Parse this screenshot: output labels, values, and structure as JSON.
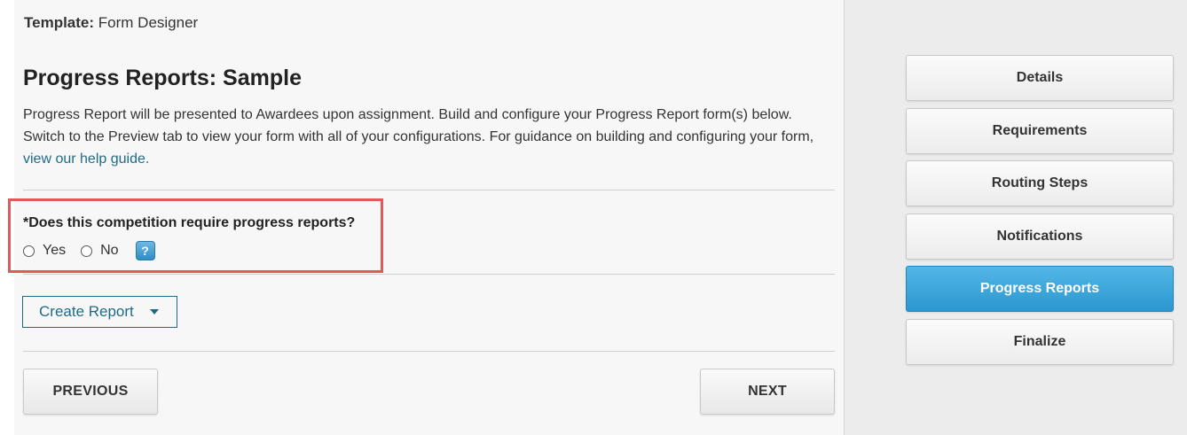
{
  "template": {
    "label": "Template:",
    "value": "Form Designer"
  },
  "page": {
    "title": "Progress Reports: Sample",
    "description_line1": "Progress Report will be presented to Awardees upon assignment. Build and configure your Progress Report form(s) below.",
    "description_line2": "Switch to the Preview tab to view your form with all of your configurations. For guidance on building and configuring your form,",
    "help_link": "view our help guide."
  },
  "question": {
    "label": "*Does this competition require progress reports?",
    "options": [
      "Yes",
      "No"
    ],
    "selected": null,
    "help_icon": "?"
  },
  "actions": {
    "create_report": "Create Report",
    "previous": "PREVIOUS",
    "next": "NEXT"
  },
  "sidebar": {
    "items": [
      {
        "label": "Details",
        "active": false
      },
      {
        "label": "Requirements",
        "active": false
      },
      {
        "label": "Routing Steps",
        "active": false
      },
      {
        "label": "Notifications",
        "active": false
      },
      {
        "label": "Progress Reports",
        "active": true
      },
      {
        "label": "Finalize",
        "active": false
      }
    ]
  },
  "colors": {
    "accent": "#2a97cf",
    "link": "#1f6b87",
    "highlight_border": "#e05a5a"
  }
}
